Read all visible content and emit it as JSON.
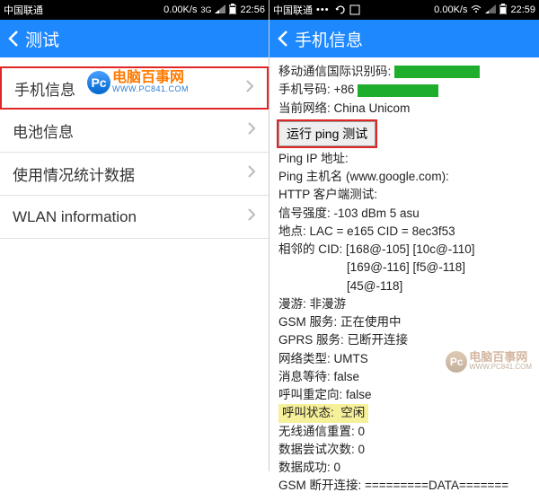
{
  "left": {
    "status": {
      "carrier": "中国联通",
      "speed": "0.00K/s",
      "net_label": "3G",
      "time": "22:56"
    },
    "header": {
      "title": "测试"
    },
    "items": [
      {
        "label": "手机信息"
      },
      {
        "label": "电池信息"
      },
      {
        "label": "使用情况统计数据"
      },
      {
        "label": "WLAN information"
      }
    ],
    "watermark": {
      "cn": "电脑百事网",
      "en": "WWW.PC841.COM"
    }
  },
  "right": {
    "status": {
      "carrier": "中国联通",
      "speed": "0.00K/s",
      "time": "22:59"
    },
    "header": {
      "title": "手机信息"
    },
    "imei_label": "移动通信国际识别码:",
    "phone": {
      "label": "手机号码:",
      "prefix": "+86"
    },
    "network": {
      "label": "当前网络:",
      "value": "China Unicom"
    },
    "ping_button": "运行 ping 测试",
    "lines": {
      "ping_ip": "Ping IP 地址:",
      "ping_host": "Ping 主机名 (www.google.com):",
      "http_test": "HTTP 客户端测试:",
      "signal": "信号强度:  -103 dBm   5 asu",
      "location": "地点:  LAC = e165    CID = 8ec3f53",
      "neighbors_label": "相邻的 CID:",
      "neighbors_1": "[168@-105] [10c@-110]",
      "neighbors_2": "[169@-116] [f5@-118]",
      "neighbors_3": "[45@-118]",
      "roaming": "漫游:   非漫游",
      "gsm_service": "GSM 服务:   正在使用中",
      "gprs_service": "GPRS 服务:   已断开连接",
      "net_type": "网络类型:   UMTS",
      "msg_wait": "消息等待:   false",
      "call_redirect": "呼叫重定向:   false",
      "call_state_label": "呼叫状态:",
      "call_state_value": "空闲",
      "radio_reset": "无线通信重置:   0",
      "data_attempts": "数据尝试次数:   0",
      "data_success": "数据成功:   0",
      "gsm_disconnect": "GSM 断开连接:   =========DATA======="
    },
    "watermark": {
      "cn": "电脑百事网",
      "en": "WWW.PC841.COM"
    }
  }
}
